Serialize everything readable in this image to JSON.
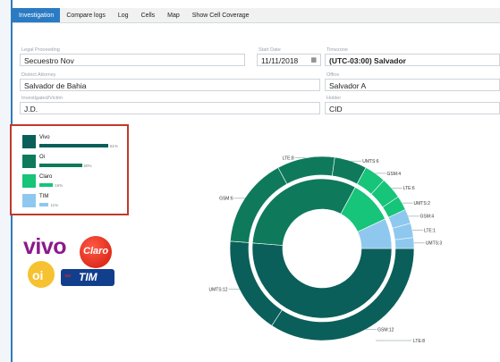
{
  "tabs": [
    {
      "label": "Investigation",
      "active": true
    },
    {
      "label": "Compare logs",
      "active": false
    },
    {
      "label": "Log",
      "active": false
    },
    {
      "label": "Cells",
      "active": false
    },
    {
      "label": "Map",
      "active": false
    },
    {
      "label": "Show Cell Coverage",
      "active": false
    }
  ],
  "form": {
    "legal_proceeding": {
      "label": "Legal Proceeding",
      "value": "Secuestro Nov"
    },
    "start_date": {
      "label": "Start Date",
      "value": "11/11/2018"
    },
    "timezone": {
      "label": "Timezone",
      "value": "(UTC-03:00) Salvador"
    },
    "district_attorney": {
      "label": "District Attorney",
      "value": "Salvador de Bahia"
    },
    "office": {
      "label": "Office",
      "value": "Salvador A"
    },
    "investigated": {
      "label": "Investigated/Victim",
      "value": "J.D."
    },
    "holder": {
      "label": "Holder",
      "value": "CID"
    }
  },
  "legend": [
    {
      "name": "Vivo",
      "pct_label": "81%",
      "value": 81,
      "color": "#0b5f5a"
    },
    {
      "name": "Oi",
      "pct_label": "50%",
      "value": 50,
      "color": "#0e7a5b"
    },
    {
      "name": "Claro",
      "pct_label": "16%",
      "value": 16,
      "color": "#16c47a"
    },
    {
      "name": "TIM",
      "pct_label": "11%",
      "value": 11,
      "color": "#8fc8ee"
    }
  ],
  "logos": {
    "vivo": "vivo",
    "claro": "Claro",
    "oi": "oi",
    "tim": "TIM"
  },
  "chart_data": {
    "type": "sunburst",
    "inner": [
      {
        "name": "Vivo",
        "value": 81,
        "color": "#0b5f5a"
      },
      {
        "name": "Oi",
        "value": 50,
        "color": "#0e7a5b"
      },
      {
        "name": "Claro",
        "value": 16,
        "color": "#16c47a"
      },
      {
        "name": "TIM",
        "value": 11,
        "color": "#8fc8ee"
      }
    ],
    "outer": [
      {
        "label": "GSM:12",
        "group": "Vivo",
        "value": 54
      },
      {
        "label": "UMTS:12",
        "group": "Vivo",
        "value": 27
      },
      {
        "label": "GSM:6",
        "group": "Oi",
        "value": 25
      },
      {
        "label": "LTE:8",
        "group": "Oi",
        "value": 16
      },
      {
        "label": "UMTS:6",
        "group": "Oi",
        "value": 9
      },
      {
        "label": "GSM:4",
        "group": "Claro",
        "value": 6
      },
      {
        "label": "LTE:6",
        "group": "Claro",
        "value": 6
      },
      {
        "label": "UMTS:2",
        "group": "Claro",
        "value": 4
      },
      {
        "label": "GSM:4",
        "group": "TIM",
        "value": 4
      },
      {
        "label": "LTE:1",
        "group": "TIM",
        "value": 4
      },
      {
        "label": "UMTS:3",
        "group": "TIM",
        "value": 3
      }
    ],
    "extra_labels": [
      "LTE:8"
    ]
  }
}
